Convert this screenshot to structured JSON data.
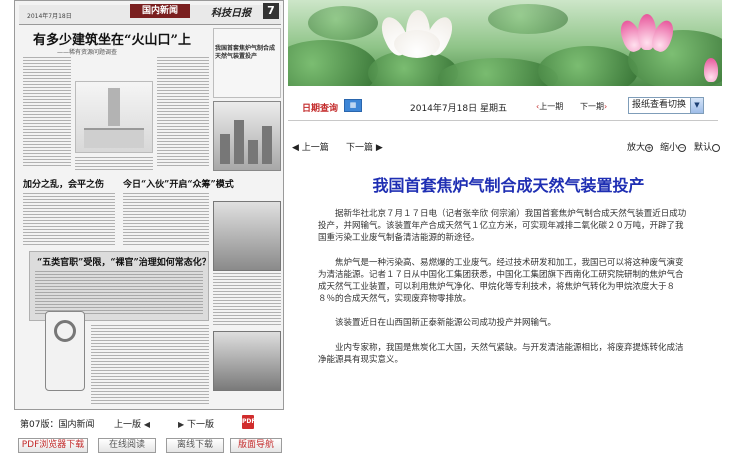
{
  "newspaper_thumbnail": {
    "date_line": "2014年7月18日",
    "section_badge": "国内新闻",
    "logo": "科技日报",
    "page_number": "7",
    "main_headline": "有多少建筑坐在“火山口”上",
    "subheadline": "——稀有资源问题调查",
    "right_box_title": "我国首套焦炉气制合成天然气装置投产",
    "headline_2": "加分之乱，会平之伤",
    "headline_3": "今日“入伙”开启“众筹”模式",
    "headline_4": "“五类官职”受限，“裸官”治理如何常态化？"
  },
  "page_navigation": {
    "current_page": "第07版：国内新闻",
    "prev_page": "上一版",
    "next_page": "下一版",
    "pdf_icon": "pdf-icon"
  },
  "bottom_buttons": [
    {
      "label": "PDF浏览器下载"
    },
    {
      "label": "在线阅读"
    },
    {
      "label": "离线下载"
    },
    {
      "label": "版面导航"
    }
  ],
  "toolbar": {
    "date_query": "日期查询",
    "date_text": "2014年7月18日   星期五",
    "prev_issue": "上一期",
    "next_issue": "下一期",
    "newspaper_switch": "报纸查看切换"
  },
  "article_nav": {
    "prev_article": "上一篇",
    "next_article": "下一篇",
    "zoom_in": "放大",
    "zoom_out": "缩小",
    "default": "默认"
  },
  "article": {
    "headline": "我国首套焦炉气制合成天然气装置投产",
    "paragraphs": [
      "据新华社北京７月１７日电（记者张辛欣 何宗渝）我国首套焦炉气制合成天然气装置近日成功投产，并网输气。该装置年产合成天然气１亿立方米，可实现年减排二氧化碳２０万吨，开辟了我国重污染工业废气制备清洁能源的新途径。",
      "焦炉气是一种污染高、易燃爆的工业废气。经过技术研发和加工，我国已可以将这种废气演变为清洁能源。记者１７日从中国化工集团获悉，中国化工集团旗下西南化工研究院研制的焦炉气合成天然气工业装置，可以利用焦炉气净化、甲烷化等专利技术，将焦炉气转化为甲烷浓度大于８８％的合成天然气，实现废弃物零排放。",
      "该装置近日在山西国新正泰新能源公司成功投产并网输气。",
      "业内专家称，我国是焦炭化工大国，天然气紧缺。与开发清洁能源相比，将废弃提炼转化成洁净能源具有现实意义。"
    ]
  }
}
